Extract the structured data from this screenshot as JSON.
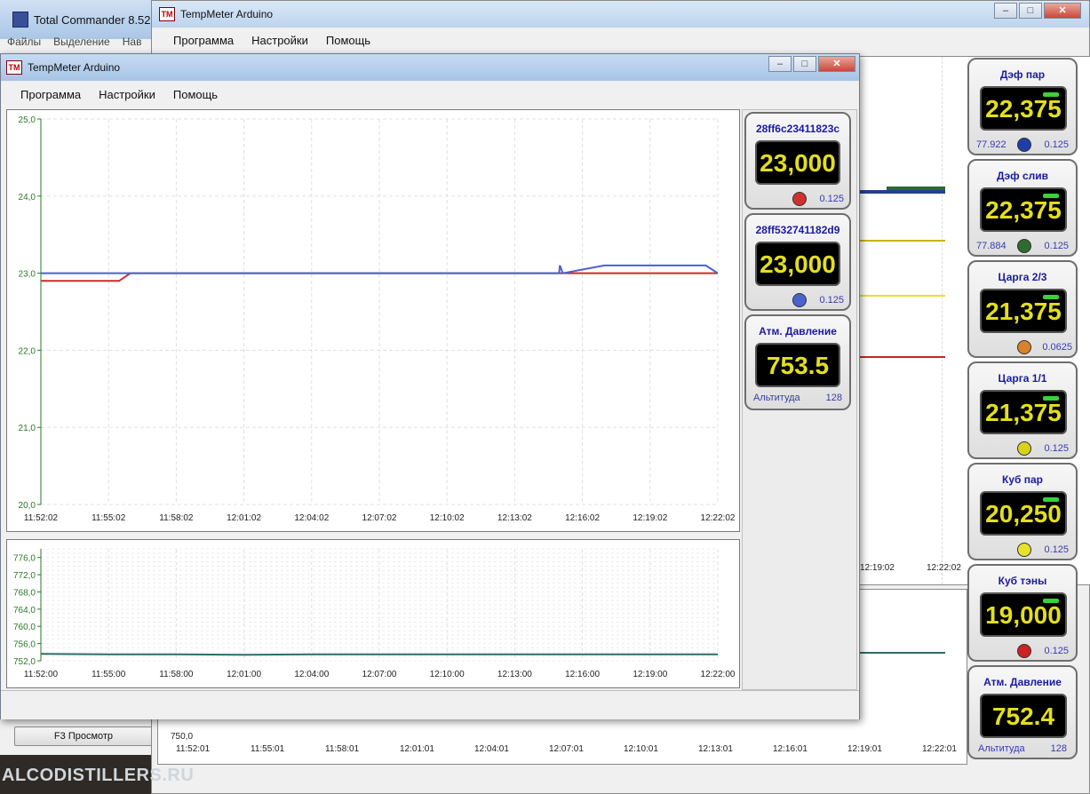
{
  "total_commander": {
    "title": "Total Commander 8.52 -",
    "menu": [
      "Файлы",
      "Выделение",
      "Нав"
    ],
    "f3_button": "F3 Просмотр"
  },
  "watermark": "ALCODISTILLERS.RU",
  "background_window": {
    "title": "TempMeter Arduino",
    "menu": [
      "Программа",
      "Настройки",
      "Помощь"
    ],
    "temp_chart_x_ticks": [
      "12:19:02",
      "12:22:02"
    ],
    "pressure_chart": {
      "y_tick": "750,0",
      "x_ticks": [
        "11:52:01",
        "11:55:01",
        "11:58:01",
        "12:01:01",
        "12:04:01",
        "12:07:01",
        "12:10:01",
        "12:13:01",
        "12:16:01",
        "12:19:01",
        "12:22:01"
      ]
    },
    "sensors": [
      {
        "name": "Дэф пар",
        "value": "22,375",
        "left": "77.922",
        "step": "0.125",
        "color": "#1f3fa8"
      },
      {
        "name": "Дэф слив",
        "value": "22,375",
        "left": "77.884",
        "step": "0.125",
        "color": "#2e6b2e"
      },
      {
        "name": "Царга 2/3",
        "value": "21,375",
        "left": "",
        "step": "0.0625",
        "color": "#d9822b"
      },
      {
        "name": "Царга 1/1",
        "value": "21,375",
        "left": "",
        "step": "0.125",
        "color": "#d8d21e"
      },
      {
        "name": "Куб пар",
        "value": "20,250",
        "left": "",
        "step": "0.125",
        "color": "#e8e22c"
      },
      {
        "name": "Куб тэны",
        "value": "19,000",
        "left": "",
        "step": "0.125",
        "color": "#cc2222"
      }
    ],
    "pressure": {
      "name": "Атм. Давление",
      "value": "752.4",
      "alt_label": "Альтитуда",
      "alt_value": "128"
    }
  },
  "front_window": {
    "title": "TempMeter Arduino",
    "menu": [
      "Программа",
      "Настройки",
      "Помощь"
    ],
    "sensors": [
      {
        "name": "28ff6c23411823c",
        "value": "23,000",
        "step": "0.125",
        "color": "#d23030"
      },
      {
        "name": "28ff532741182d9",
        "value": "23,000",
        "step": "0.125",
        "color": "#4a62cf"
      }
    ],
    "pressure": {
      "name": "Атм. Давление",
      "value": "753.5",
      "alt_label": "Альтитуда",
      "alt_value": "128"
    }
  },
  "chart_data": [
    {
      "type": "line",
      "title": "",
      "xlabel": "",
      "ylabel": "",
      "ylim": [
        20.0,
        25.0
      ],
      "y_ticks": [
        "25,0",
        "24,0",
        "23,0",
        "22,0",
        "21,0",
        "20,0"
      ],
      "x": [
        "11:52:02",
        "11:55:02",
        "11:58:02",
        "12:01:02",
        "12:04:02",
        "12:07:02",
        "12:10:02",
        "12:13:02",
        "12:16:02",
        "12:19:02",
        "12:22:02"
      ],
      "series": [
        {
          "color": "#cc2a2a",
          "points": [
            [
              "11:52:02",
              22.9
            ],
            [
              "11:53:00",
              22.9
            ],
            [
              "11:54:00",
              22.9
            ],
            [
              "11:55:00",
              22.9
            ],
            [
              "11:55:30",
              22.9
            ],
            [
              "11:56:00",
              23.0
            ],
            [
              "12:22:02",
              23.0
            ]
          ]
        },
        {
          "color": "#4a62cf",
          "points": [
            [
              "11:52:02",
              23.0
            ],
            [
              "12:15:00",
              23.0
            ],
            [
              "12:15:02",
              23.1
            ],
            [
              "12:15:10",
              23.0
            ],
            [
              "12:17:00",
              23.1
            ],
            [
              "12:19:00",
              23.1
            ],
            [
              "12:21:30",
              23.1
            ],
            [
              "12:22:02",
              23.0
            ]
          ]
        }
      ],
      "grid": true
    },
    {
      "type": "line",
      "title": "",
      "xlabel": "",
      "ylabel": "",
      "ylim": [
        752.0,
        778.0
      ],
      "y_ticks": [
        "776,0",
        "772,0",
        "768,0",
        "764,0",
        "760,0",
        "756,0",
        "752,0"
      ],
      "x": [
        "11:52:00",
        "11:55:00",
        "11:58:00",
        "12:01:00",
        "12:04:00",
        "12:07:00",
        "12:10:00",
        "12:13:00",
        "12:16:00",
        "12:19:00",
        "12:22:00"
      ],
      "series": [
        {
          "color": "#2f6b6b",
          "values": [
            753.6,
            753.5,
            753.5,
            753.4,
            753.5,
            753.5,
            753.5,
            753.5,
            753.5,
            753.5,
            753.5
          ]
        }
      ],
      "grid": true
    }
  ]
}
